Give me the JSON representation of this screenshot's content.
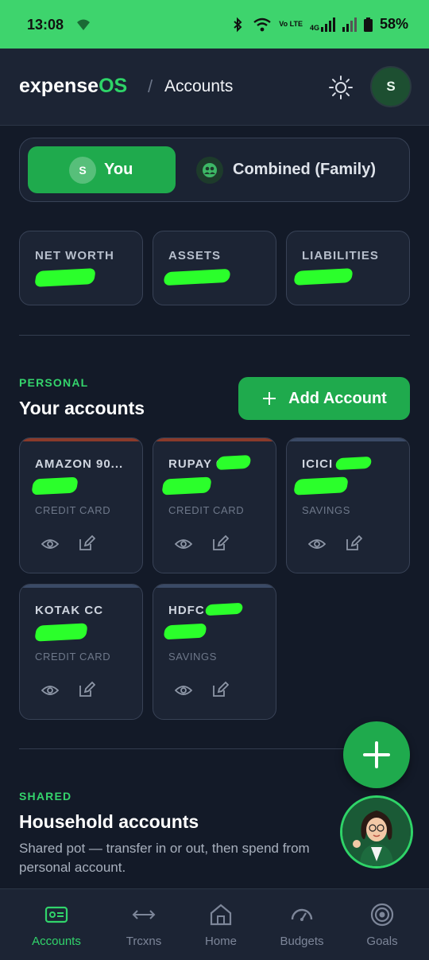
{
  "status_bar": {
    "time": "13:08",
    "network_line1": "Vo LTE",
    "network_line2": "4G",
    "battery": "58%",
    "icons": [
      "wifi-calling-icon",
      "bluetooth-icon",
      "wifi-icon",
      "signal-icon",
      "battery-icon"
    ]
  },
  "header": {
    "brand_main": "expense",
    "brand_accent": "OS",
    "separator": "/",
    "page": "Accounts",
    "avatar_initial": "S"
  },
  "scope": {
    "you_badge": "S",
    "you_label": "You",
    "family_label": "Combined (Family)"
  },
  "stats": [
    {
      "label": "NET WORTH"
    },
    {
      "label": "ASSETS"
    },
    {
      "label": "LIABILITIES"
    }
  ],
  "personal": {
    "tag": "PERSONAL",
    "title": "Your accounts",
    "add_button": "Add Account"
  },
  "accounts": [
    {
      "name": "AMAZON 90...",
      "type": "CREDIT CARD",
      "accent": "#8a3a2a"
    },
    {
      "name": "RUPAY 6",
      "type": "CREDIT CARD",
      "accent": "#8a3a2a"
    },
    {
      "name": "ICICI",
      "type": "SAVINGS",
      "accent": "#3a4a66"
    },
    {
      "name": "KOTAK CC",
      "type": "CREDIT CARD",
      "accent": "#3a4a66"
    },
    {
      "name": "HDFC",
      "type": "SAVINGS",
      "accent": "#3a4a66"
    }
  ],
  "shared": {
    "tag": "SHARED",
    "title": "Household accounts",
    "description": "Shared pot — transfer in or out, then spend from personal account."
  },
  "nav": [
    {
      "label": "Accounts",
      "icon": "wallet-icon",
      "active": true
    },
    {
      "label": "Trcxns",
      "icon": "transfer-arrows-icon",
      "active": false
    },
    {
      "label": "Home",
      "icon": "home-icon",
      "active": false
    },
    {
      "label": "Budgets",
      "icon": "gauge-icon",
      "active": false
    },
    {
      "label": "Goals",
      "icon": "target-icon",
      "active": false
    }
  ],
  "colors": {
    "accent": "#1faa4d",
    "brand_green": "#2ed468",
    "background": "#131a28",
    "card": "#1c2434",
    "status_bar": "#3ed46d"
  }
}
